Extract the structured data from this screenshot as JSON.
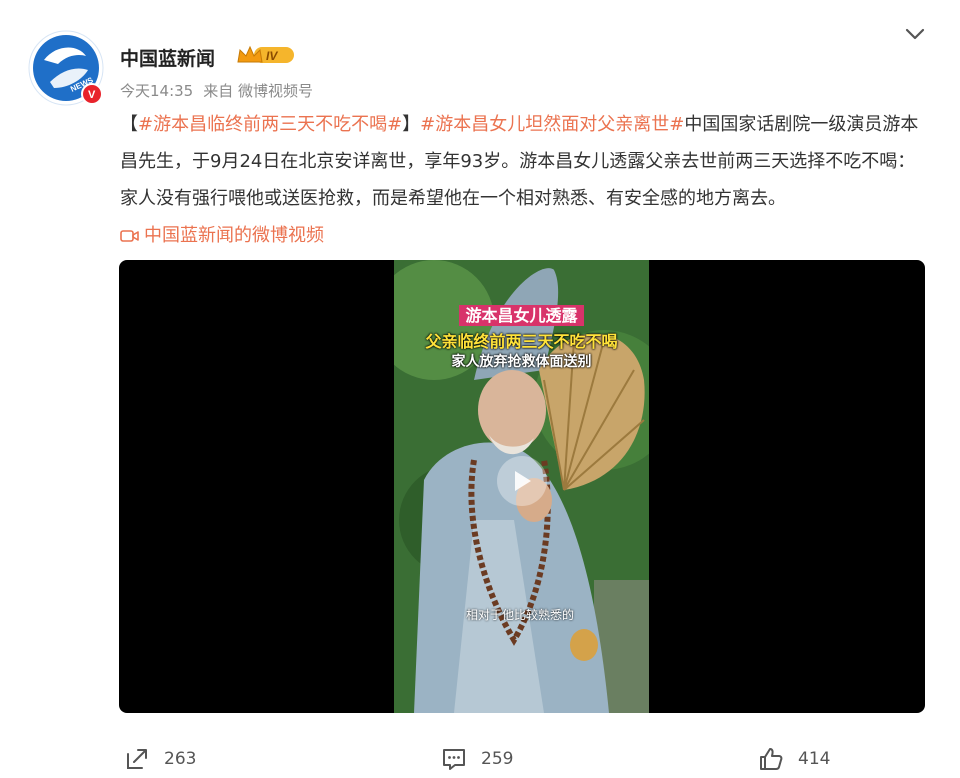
{
  "author": {
    "name": "中国蓝新闻",
    "level_badge": "IV",
    "avatar_text": "NEWS",
    "verified_mark": "V"
  },
  "meta": {
    "time": "今天14:35",
    "source_prefix": "来自",
    "source": "微博视频号"
  },
  "post": {
    "bracket_open": "【",
    "hashtag_1": "#游本昌临终前两三天不吃不喝#",
    "bracket_close": "】",
    "hashtag_2": "#游本昌女儿坦然面对父亲离世#",
    "body": "中国国家话剧院一级演员游本昌先生，于9月24日在北京安详离世，享年93岁。游本昌女儿透露父亲去世前两三天选择不吃不喝：家人没有强行喂他或送医抢救，而是希望他在一个相对熟悉、有安全感的地方离去。",
    "video_link": "中国蓝新闻的微博视频"
  },
  "video": {
    "caption_1": "游本昌女儿透露",
    "caption_2": "父亲临终前两三天不吃不喝",
    "caption_3": "家人放弃抢救体面送别",
    "subtitle": "相对于他比较熟悉的"
  },
  "actions": {
    "share_count": "263",
    "comment_count": "259",
    "like_count": "414"
  },
  "colors": {
    "link": "#eb7350",
    "avatar_blue": "#1f6fc8",
    "badge_gold": "#f5b52c"
  }
}
